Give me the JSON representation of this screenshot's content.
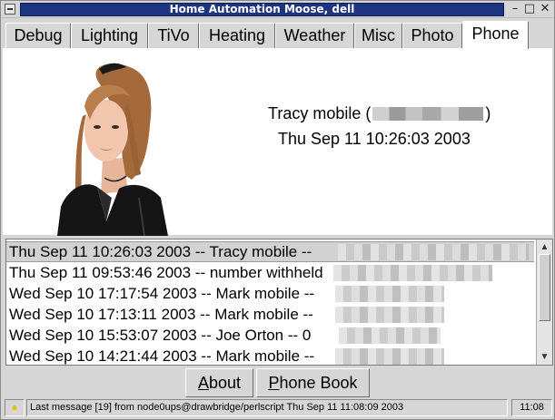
{
  "window": {
    "title": "Home Automation Moose, dell",
    "buttons": {
      "minimize": "–",
      "maximize": "□",
      "close": "✕"
    }
  },
  "tabs": [
    {
      "label": "Debug"
    },
    {
      "label": "Lighting"
    },
    {
      "label": "TiVo"
    },
    {
      "label": "Heating"
    },
    {
      "label": "Weather"
    },
    {
      "label": "Misc"
    },
    {
      "label": "Photo"
    },
    {
      "label": "Phone",
      "active": true
    }
  ],
  "phone": {
    "caller_name": "Tracy mobile",
    "caller_open": "(",
    "caller_close": ")",
    "call_time": "Thu Sep 11 10:26:03 2003"
  },
  "log": [
    {
      "text": "Thu Sep 11 10:26:03 2003 -- Tracy mobile -- ",
      "selected": true
    },
    {
      "text": "Thu Sep 11 09:53:46 2003 -- number withheld"
    },
    {
      "text": "Wed Sep 10 17:17:54 2003 -- Mark mobile -- "
    },
    {
      "text": "Wed Sep 10 17:13:11 2003 -- Mark mobile -- "
    },
    {
      "text": "Wed Sep 10 15:53:07 2003 -- Joe Orton -- 0"
    },
    {
      "text": "Wed Sep 10 14:21:44 2003 -- Mark mobile -- "
    }
  ],
  "buttons": {
    "about_first": "A",
    "about_rest": "bout",
    "phonebook_first": "P",
    "phonebook_rest": "hone Book"
  },
  "status": {
    "message": "Last message [19] from node0ups@drawbridge/perlscript Thu Sep 11 11:08:09 2003",
    "clock": "11:08"
  },
  "icons": {
    "system_menu": "minus-box-icon",
    "status": "lightbulb-icon"
  }
}
